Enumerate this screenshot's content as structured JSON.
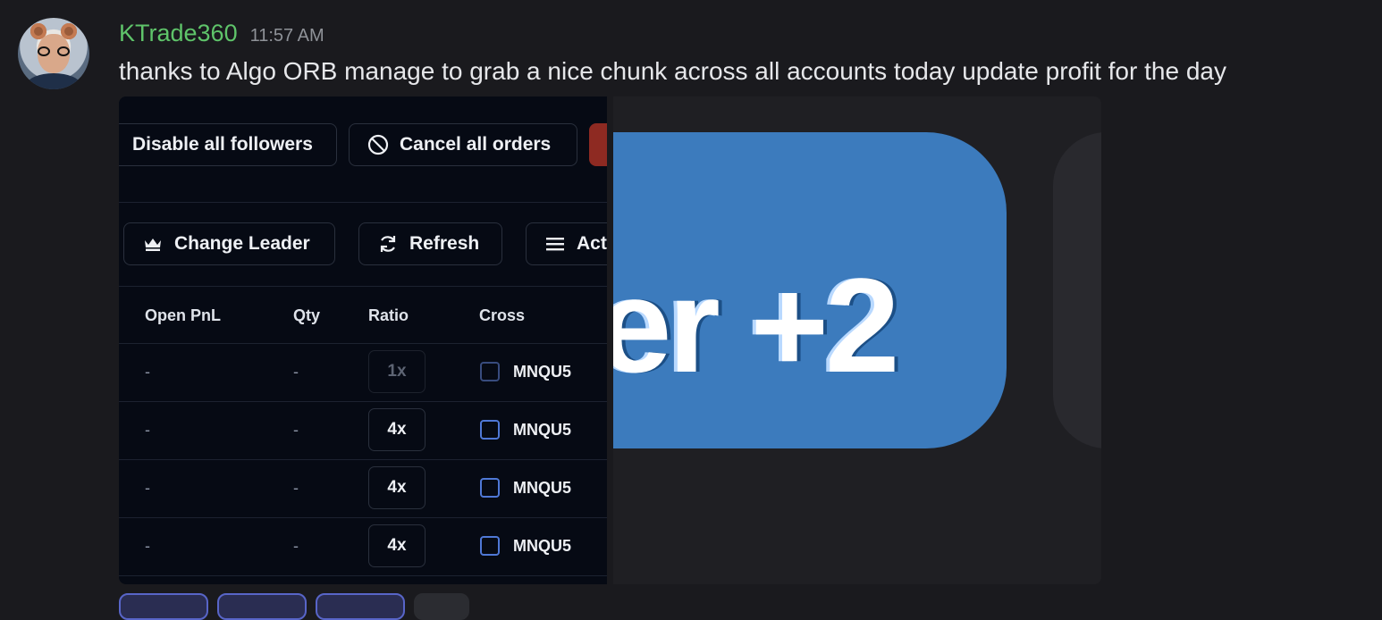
{
  "message": {
    "username": "KTrade360",
    "timestamp": "11:57 AM",
    "text": "thanks to  Algo ORB manage to grab a nice chunk across all accounts today update profit for the day",
    "username_color": "#5fc46a"
  },
  "attachment1": {
    "toolbar1": {
      "disable_followers": "Disable all followers",
      "cancel_orders": "Cancel all orders"
    },
    "toolbar2": {
      "change_leader": "Change Leader",
      "refresh": "Refresh",
      "actions": "Act"
    },
    "table": {
      "headers": [
        "Open PnL",
        "Qty",
        "Ratio",
        "Cross"
      ],
      "rows": [
        {
          "open_pnl": "-",
          "qty": "-",
          "ratio": "1x",
          "symbol": "MNQU5"
        },
        {
          "open_pnl": "-",
          "qty": "-",
          "ratio": "4x",
          "symbol": "MNQU5"
        },
        {
          "open_pnl": "-",
          "qty": "-",
          "ratio": "4x",
          "symbol": "MNQU5"
        },
        {
          "open_pnl": "-",
          "qty": "-",
          "ratio": "4x",
          "symbol": "MNQU5"
        }
      ]
    }
  },
  "attachment2": {
    "text": "er +2",
    "pill_color": "#3c7bbd"
  },
  "icons": {
    "crown": "crown-icon",
    "refresh": "refresh-icon",
    "menu": "menu-icon",
    "cancel": "ban-icon"
  }
}
